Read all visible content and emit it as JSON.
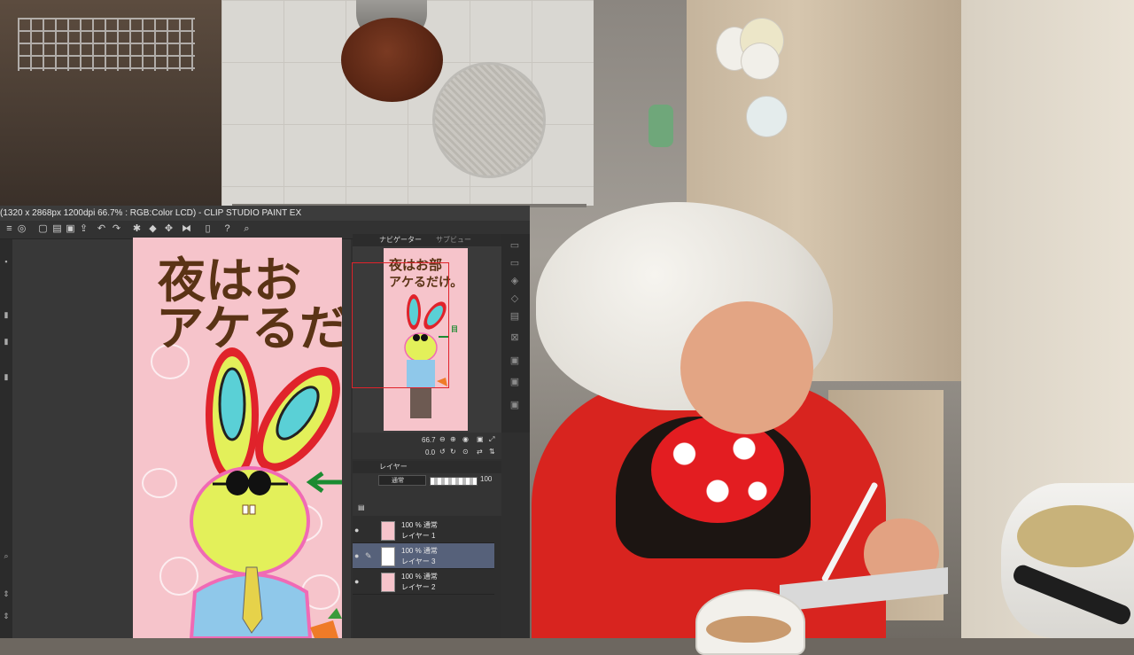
{
  "app": {
    "title": "(1320 x 2868px 1200dpi 66.7% : RGB:Color LCD) - CLIP STUDIO PAINT EX"
  },
  "panels": {
    "navigator_tab": "ナビゲーター",
    "subview_tab": "サブビュー",
    "zoom_value": "66.7",
    "rotation_value": "0.0",
    "layer_tab": "レイヤー",
    "blend_mode": "通常",
    "opacity_value": "100"
  },
  "layers": [
    {
      "meta": "100 % 通常",
      "name": "レイヤー 1",
      "thumb_color": "#f6c4cb",
      "selected": false
    },
    {
      "meta": "100 % 通常",
      "name": "レイヤー 3",
      "thumb_color": "#ffffff",
      "selected": true
    },
    {
      "meta": "100 % 通常",
      "name": "レイヤー 2",
      "thumb_color": "#f6c4cb",
      "selected": false
    }
  ],
  "canvas_art": {
    "line1": "夜はお",
    "line2": "アケるだ",
    "nav_line1": "夜はお部",
    "nav_line2": "アケるだけ。",
    "arrow_glyph": "←",
    "nav_label": "目"
  },
  "colors": {
    "canvas_pink": "#f6c4cb",
    "bunny_yellow": "#e3f05a",
    "shirt_blue": "#8fc8ea",
    "accent_red": "#e0232b",
    "selected_layer": "#56617a"
  }
}
